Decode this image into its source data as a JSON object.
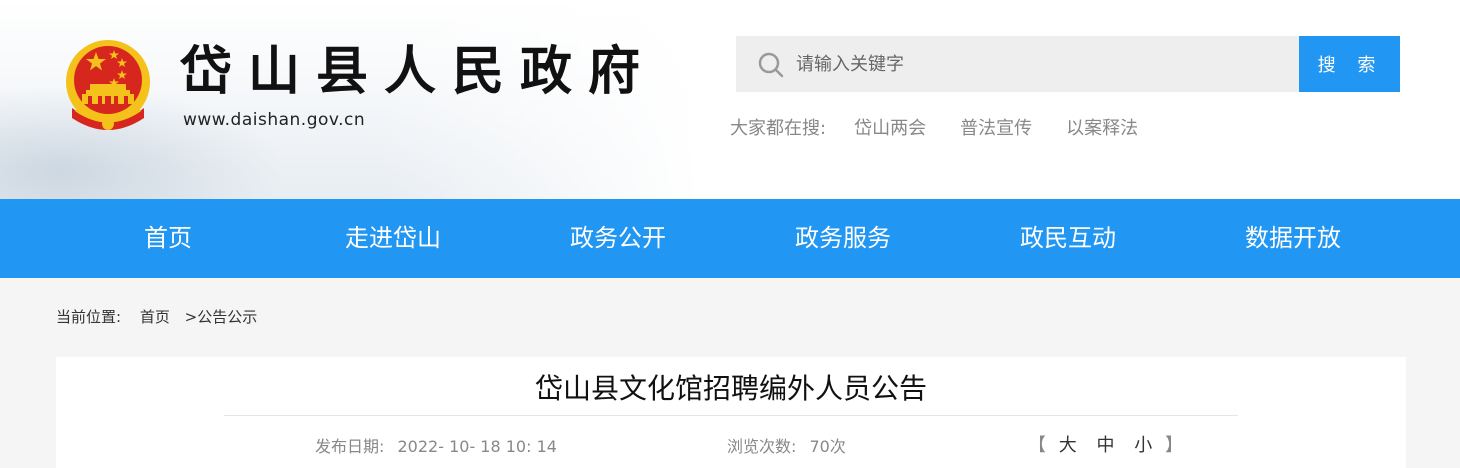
{
  "header": {
    "site_title": "岱山县人民政府",
    "site_url": "www.daishan.gov.cn"
  },
  "search": {
    "placeholder": "请输入关键字",
    "button_label": "搜 索",
    "hot_label": "大家都在搜:",
    "hot_items": [
      "岱山两会",
      "普法宣传",
      "以案释法"
    ]
  },
  "nav": {
    "items": [
      "首页",
      "走进岱山",
      "政务公开",
      "政务服务",
      "政民互动",
      "数据开放"
    ]
  },
  "breadcrumb": {
    "label": "当前位置:",
    "home": "首页",
    "current": ">公告公示"
  },
  "article": {
    "title": "岱山县文化馆招聘编外人员公告",
    "date_label": "发布日期:",
    "date_value": "2022- 10- 18 10: 14",
    "views_label": "浏览次数:",
    "views_value": "70次",
    "font_size": {
      "open": "【",
      "large": "大",
      "medium": "中",
      "small": "小",
      "close": "】"
    }
  },
  "colors": {
    "accent": "#2196f3",
    "emblem_red": "#d7261e",
    "emblem_gold": "#f4c21b"
  }
}
